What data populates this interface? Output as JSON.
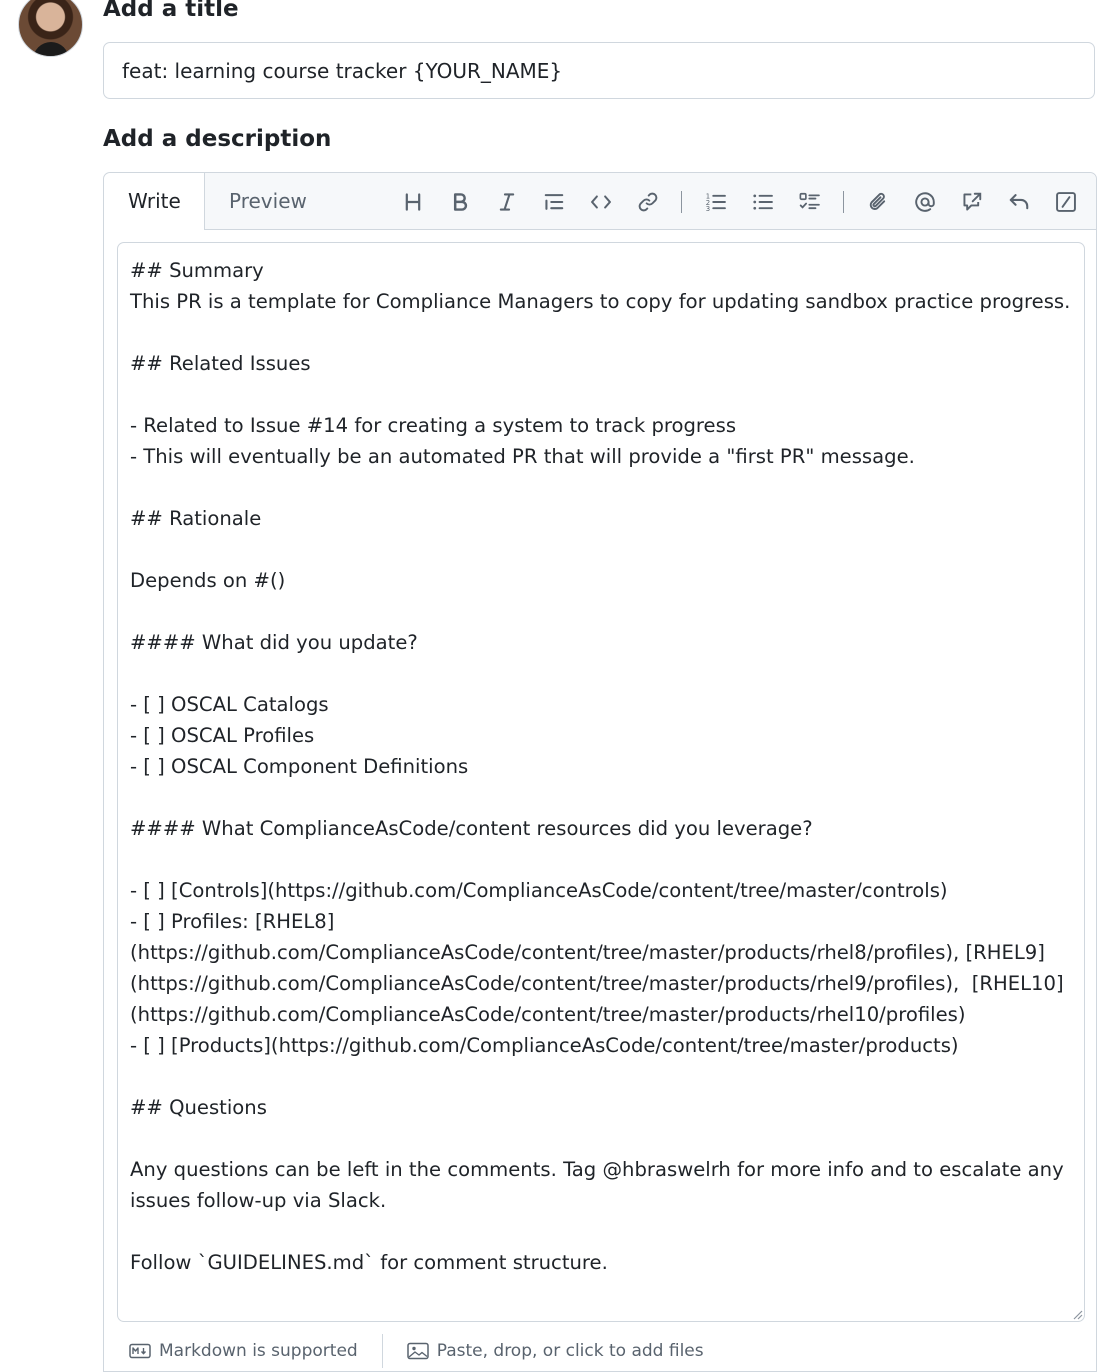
{
  "form": {
    "title_label": "Add a title",
    "title_value": "feat: learning course tracker {YOUR_NAME}",
    "description_label": "Add a description"
  },
  "editor": {
    "tabs": {
      "write": "Write",
      "preview": "Preview"
    },
    "toolbar_icons": [
      "heading-icon",
      "bold-icon",
      "italic-icon",
      "quote-icon",
      "code-icon",
      "link-icon",
      "ordered-list-icon",
      "unordered-list-icon",
      "task-list-icon",
      "attach-icon",
      "mention-icon",
      "reference-icon",
      "undo-icon",
      "slash-command-icon"
    ],
    "body": "## Summary\nThis PR is a template for Compliance Managers to copy for updating sandbox practice progress.\n\n## Related Issues\n\n- Related to Issue #14 for creating a system to track progress\n- This will eventually be an automated PR that will provide a \"first PR\" message.\n\n## Rationale\n\nDepends on #()\n\n#### What did you update?\n\n- [ ] OSCAL Catalogs\n- [ ] OSCAL Profiles\n- [ ] OSCAL Component Definitions\n\n#### What ComplianceAsCode/content resources did you leverage?\n\n- [ ] [Controls](https://github.com/ComplianceAsCode/content/tree/master/controls)\n- [ ] Profiles: [RHEL8]\n(https://github.com/ComplianceAsCode/content/tree/master/products/rhel8/profiles), [RHEL9]\n(https://github.com/ComplianceAsCode/content/tree/master/products/rhel9/profiles),  [RHEL10]\n(https://github.com/ComplianceAsCode/content/tree/master/products/rhel10/profiles)\n- [ ] [Products](https://github.com/ComplianceAsCode/content/tree/master/products)\n\n## Questions\n\nAny questions can be left in the comments. Tag @hbraswelrh for more info and to escalate any\nissues follow-up via Slack.\n\nFollow `GUIDELINES.md` for comment structure.",
    "footer": {
      "markdown_note": "Markdown is supported",
      "files_note": "Paste, drop, or click to add files"
    }
  }
}
